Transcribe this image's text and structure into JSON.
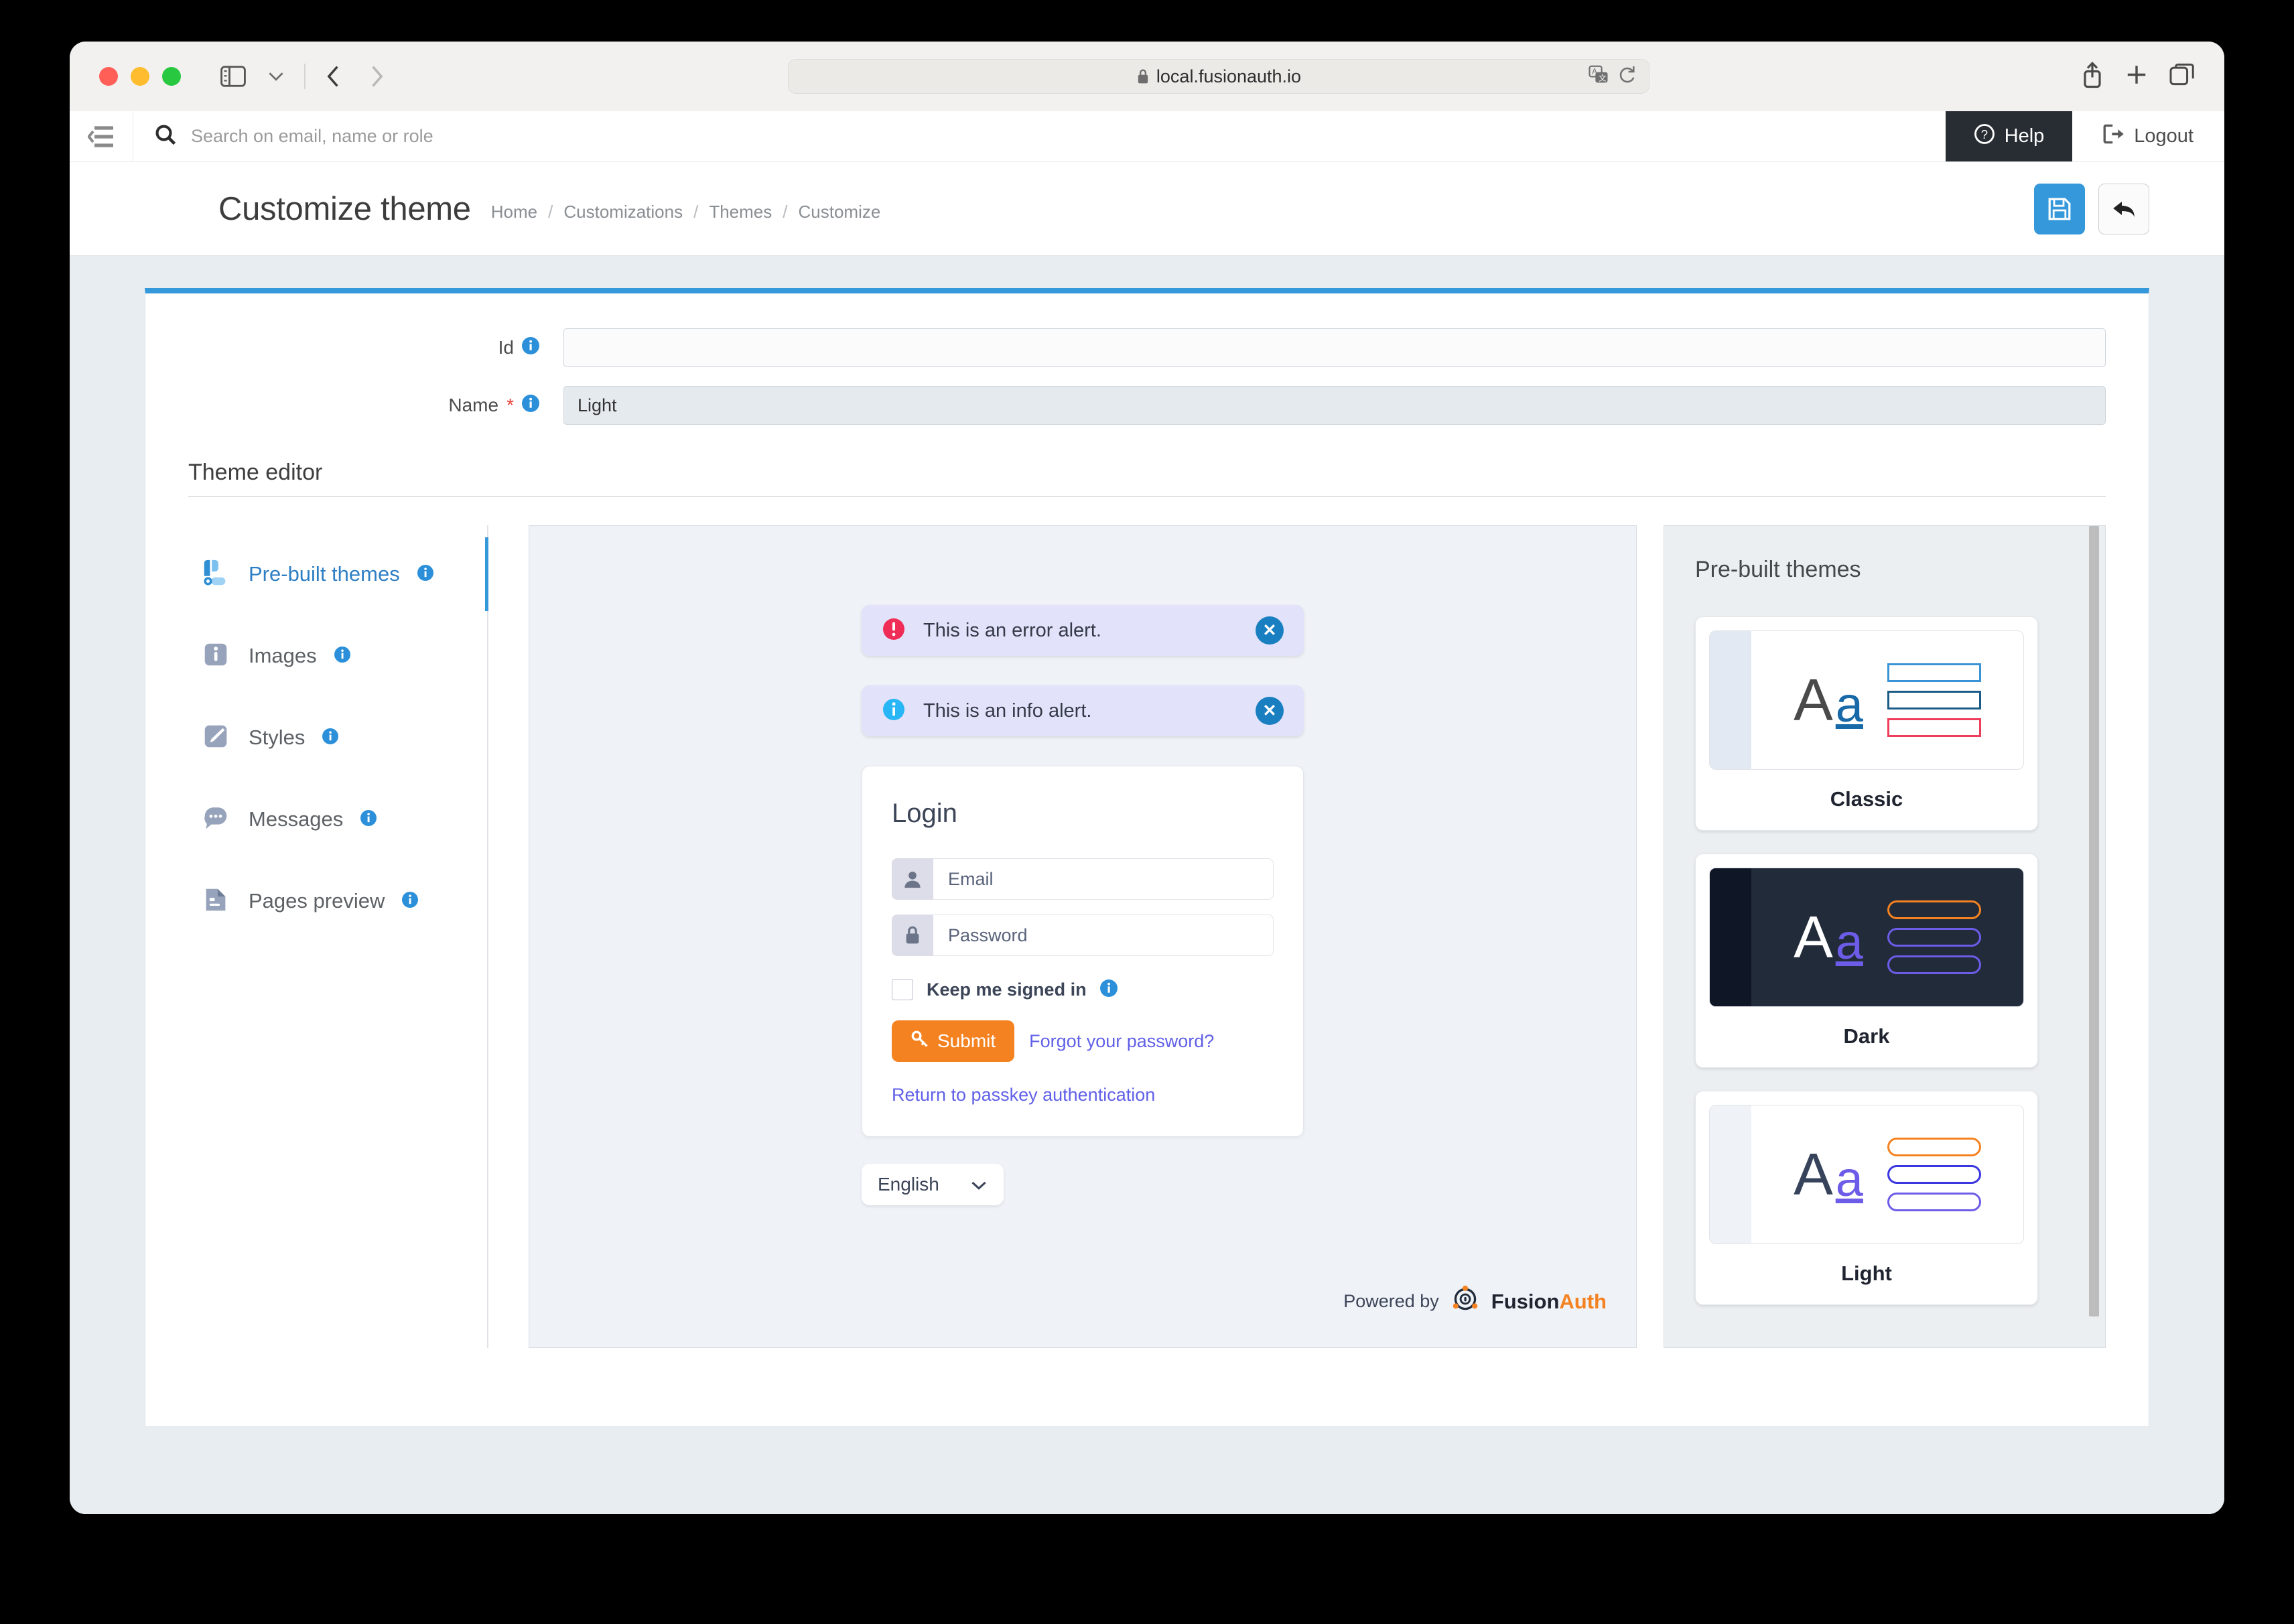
{
  "browser": {
    "url": "local.fusionauth.io",
    "lock_icon": "lock-icon",
    "sidebar_icon": "sidebar-toggle-icon",
    "back_icon": "back-chevron-icon",
    "forward_icon": "forward-chevron-icon",
    "translate_icon": "translate-icon",
    "reload_icon": "reload-icon",
    "share_icon": "share-icon",
    "newtab_icon": "new-tab-icon",
    "tabs_icon": "tab-overview-icon"
  },
  "appbar": {
    "collapse_icon": "collapse-menu-icon",
    "search_icon": "search-icon",
    "search_value": "",
    "search_placeholder": "Search on email, name or role",
    "help_label": "Help",
    "help_icon": "question-circle-icon",
    "logout_label": "Logout",
    "logout_icon": "logout-icon"
  },
  "page": {
    "title": "Customize theme",
    "breadcrumb": [
      "Home",
      "Customizations",
      "Themes",
      "Customize"
    ],
    "breadcrumb_separator": "/",
    "save_icon": "save-floppy-icon",
    "back_icon": "undo-arrow-icon",
    "accent_color": "#3498db"
  },
  "form": {
    "id_label": "Id",
    "id_value": "",
    "name_label": "Name",
    "name_required_marker": "*",
    "name_value": "Light",
    "info_icon": "info-icon"
  },
  "editor": {
    "section_title": "Theme editor",
    "nav_items": [
      {
        "label": "Pre-built themes",
        "icon": "prebuilt-themes-icon",
        "active": true
      },
      {
        "label": "Images",
        "icon": "images-icon",
        "active": false
      },
      {
        "label": "Styles",
        "icon": "styles-pencil-icon",
        "active": false
      },
      {
        "label": "Messages",
        "icon": "messages-bubble-icon",
        "active": false
      },
      {
        "label": "Pages preview",
        "icon": "pages-preview-icon",
        "active": false
      }
    ]
  },
  "preview": {
    "alerts": [
      {
        "text": "This is an error alert.",
        "icon": "error-exclamation-icon",
        "icon_color": "#ef2d56",
        "close_icon": "close-circle-icon"
      },
      {
        "text": "This is an info alert.",
        "icon": "info-circle-icon",
        "icon_color": "#29b6f6",
        "close_icon": "close-circle-icon"
      }
    ],
    "login": {
      "title": "Login",
      "email_placeholder": "Email",
      "email_value": "",
      "email_icon": "user-icon",
      "password_placeholder": "Password",
      "password_value": "",
      "password_icon": "lock-icon",
      "keep_signed_in_label": "Keep me signed in",
      "keep_signed_in_checked": false,
      "keep_signed_in_info_icon": "info-icon",
      "submit_label": "Submit",
      "submit_icon": "key-icon",
      "submit_color": "#f58220",
      "forgot_label": "Forgot your password?",
      "passkey_label": "Return to passkey authentication",
      "link_color": "#6060e8"
    },
    "language": {
      "selected": "English",
      "chevron_icon": "chevron-down-icon"
    },
    "footer": {
      "powered_by": "Powered by",
      "brand_first": "Fusion",
      "brand_second": "Auth",
      "logo_icon": "fusionauth-logo-icon"
    }
  },
  "themes_panel": {
    "title": "Pre-built themes",
    "cards": [
      {
        "name": "Classic",
        "selected": false,
        "thumb_bg": "#ffffff",
        "thumb_side": "#e3e9f2",
        "letter_a_color": "#4a4a4a",
        "letter_a_small_color": "#1869a8",
        "bars": [
          {
            "color": "#3a93d4",
            "radius": "0px"
          },
          {
            "color": "#1b5c86",
            "radius": "0px"
          },
          {
            "color": "#ef3e5c",
            "radius": "0px"
          }
        ]
      },
      {
        "name": "Dark",
        "selected": true,
        "thumb_bg": "#222b3a",
        "thumb_side": "#0f1726",
        "letter_a_color": "#ffffff",
        "letter_a_small_color": "#6c5ce7",
        "bars": [
          {
            "color": "#f58220",
            "radius": "14px"
          },
          {
            "color": "#6c5ce7",
            "radius": "14px"
          },
          {
            "color": "#6c5ce7",
            "radius": "14px"
          }
        ]
      },
      {
        "name": "Light",
        "selected": false,
        "thumb_bg": "#ffffff",
        "thumb_side": "#eff2f7",
        "letter_a_color": "#36435a",
        "letter_a_small_color": "#6c5ce7",
        "bars": [
          {
            "color": "#f58220",
            "radius": "14px"
          },
          {
            "color": "#3b36e0",
            "radius": "14px"
          },
          {
            "color": "#6c5ce7",
            "radius": "14px"
          }
        ]
      }
    ]
  }
}
